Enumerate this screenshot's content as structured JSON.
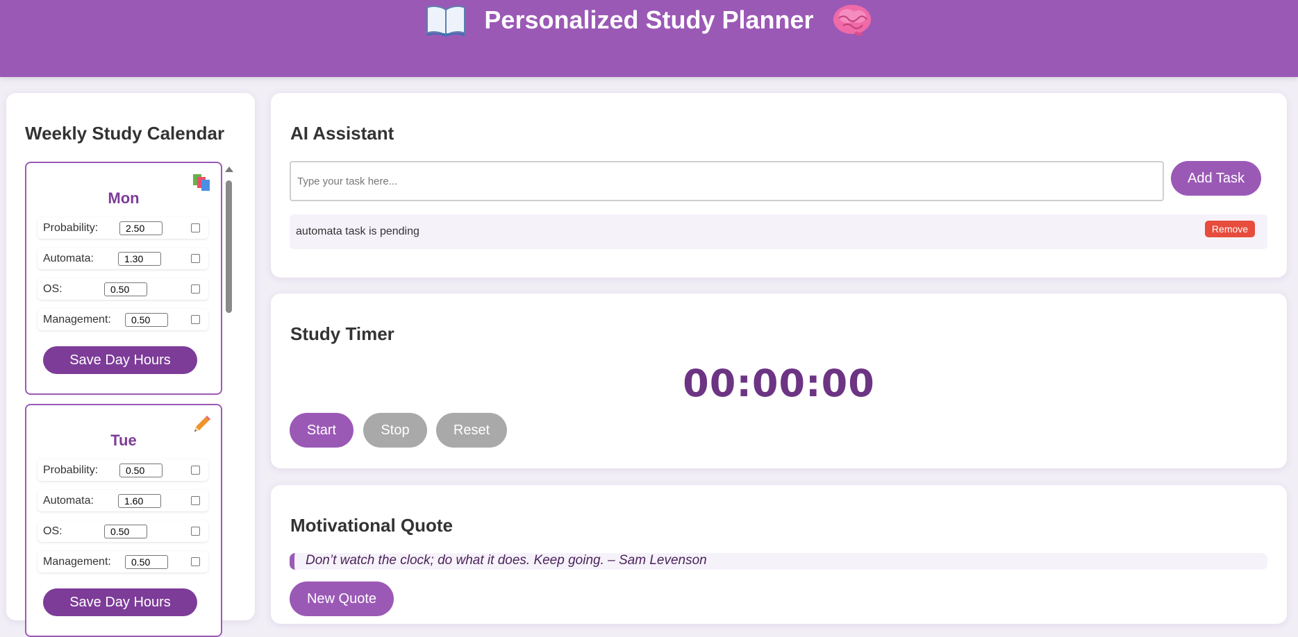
{
  "header": {
    "title": "Personalized Study Planner",
    "left_icon": "open-book-icon",
    "right_icon": "brain-icon"
  },
  "calendar": {
    "title": "Weekly Study Calendar",
    "days": [
      {
        "name": "Mon",
        "icon": "books-stack-icon",
        "subjects": [
          {
            "label": "Probability:",
            "value": "2.50",
            "checked": false
          },
          {
            "label": "Automata:",
            "value": "1.30",
            "checked": false
          },
          {
            "label": "OS:",
            "value": "0.50",
            "checked": false
          },
          {
            "label": "Management:",
            "value": "0.50",
            "checked": false
          }
        ],
        "save_label": "Save Day Hours"
      },
      {
        "name": "Tue",
        "icon": "pencil-icon",
        "subjects": [
          {
            "label": "Probability:",
            "value": "0.50",
            "checked": false
          },
          {
            "label": "Automata:",
            "value": "1.60",
            "checked": false
          },
          {
            "label": "OS:",
            "value": "0.50",
            "checked": false
          },
          {
            "label": "Management:",
            "value": "0.50",
            "checked": false
          }
        ],
        "save_label": "Save Day Hours"
      }
    ]
  },
  "ai_assistant": {
    "title": "AI Assistant",
    "input_placeholder": "Type your task here...",
    "input_value": "",
    "add_label": "Add Task",
    "tasks": [
      {
        "text": "automata task is pending",
        "remove_label": "Remove"
      }
    ]
  },
  "timer": {
    "title": "Study Timer",
    "display": "00:00:00",
    "start_label": "Start",
    "stop_label": "Stop",
    "reset_label": "Reset"
  },
  "quote": {
    "title": "Motivational Quote",
    "text": "Don’t watch the clock; do what it does. Keep going. – Sam Levenson",
    "button_label": "New Quote"
  },
  "colors": {
    "brand": "#9b59b6",
    "brand_dark": "#7d3c98",
    "timer": "#6c3483",
    "danger": "#e74c3c",
    "muted_button": "#a9a9a9"
  }
}
